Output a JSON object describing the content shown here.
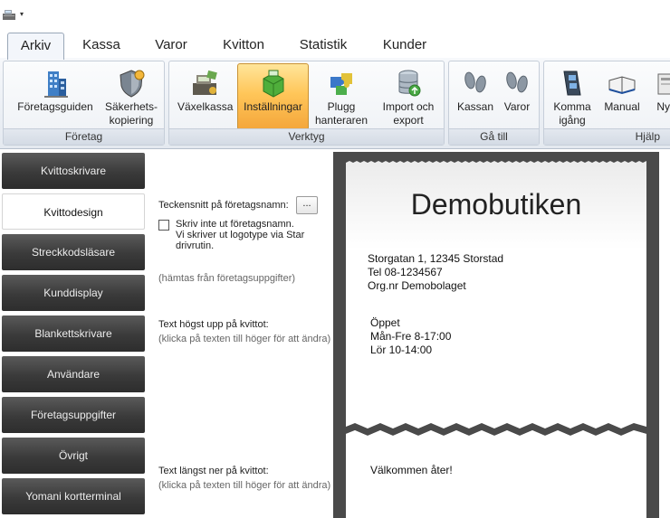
{
  "tabs": [
    "Arkiv",
    "Kassa",
    "Varor",
    "Kvitton",
    "Statistik",
    "Kunder"
  ],
  "ribbon": {
    "groups": [
      {
        "label": "Företag",
        "buttons": [
          {
            "label": "Företagsguiden",
            "icon": "building-icon"
          },
          {
            "label1": "Säkerhets-",
            "label2": "kopiering",
            "icon": "shield-icon"
          }
        ]
      },
      {
        "label": "Verktyg",
        "buttons": [
          {
            "label": "Växelkassa",
            "icon": "cash-register-icon"
          },
          {
            "label": "Inställningar",
            "icon": "settings-box-icon",
            "selected": true
          },
          {
            "label1": "Plugg",
            "label2": "hanteraren",
            "icon": "puzzle-icon"
          },
          {
            "label1": "Import och",
            "label2": "export",
            "icon": "database-icon"
          }
        ]
      },
      {
        "label": "Gå till",
        "buttons": [
          {
            "label": "Kassan",
            "icon": "footprints-icon"
          },
          {
            "label": "Varor",
            "icon": "footprints-icon"
          }
        ]
      },
      {
        "label": "Hjälp",
        "buttons": [
          {
            "label1": "Komma",
            "label2": "igång",
            "icon": "film-icon"
          },
          {
            "label": "Manual",
            "icon": "book-icon"
          },
          {
            "label": "Nyh",
            "icon": "news-icon"
          }
        ]
      }
    ]
  },
  "nav": [
    "Kvittoskrivare",
    "Kvittodesign",
    "Streckkodsläsare",
    "Kunddisplay",
    "Blankettskrivare",
    "Användare",
    "Företagsuppgifter",
    "Övrigt",
    "Yomani kortterminal"
  ],
  "nav_active": "Kvittodesign",
  "form": {
    "font_label": "Teckensnitt på företagsnamn:",
    "browse": "...",
    "checkbox_line1": "Skriv inte ut företagsnamn.",
    "checkbox_line2": "Vi skriver ut logotype via Star",
    "checkbox_line3": "drivrutin.",
    "fetched_hint": "(hämtas från företagsuppgifter)",
    "top_label": "Text högst upp på kvittot:",
    "top_hint": "(klicka på texten till höger för att ändra)",
    "bottom_label": "Text längst ner på kvittot:",
    "bottom_hint": "(klicka på texten till höger för att ändra)"
  },
  "receipt": {
    "title": "Demobutiken",
    "address": "Storgatan 1, 12345 Storstad",
    "phone": "Tel 08-1234567",
    "orgnr": "Org.nr Demobolaget",
    "open_label": "Öppet",
    "hours1": "Mån-Fre 8-17:00",
    "hours2": "Lör 10-14:00",
    "footer": "Välkommen åter!"
  }
}
